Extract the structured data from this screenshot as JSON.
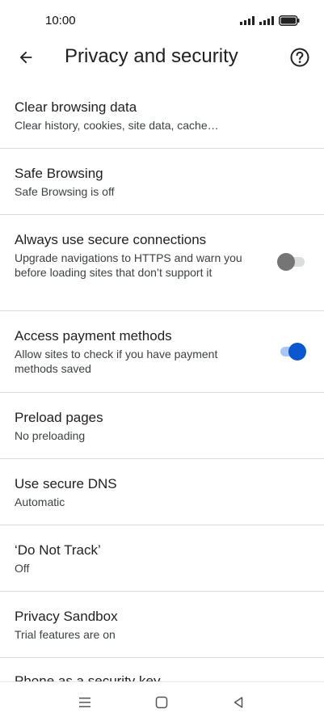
{
  "status_bar": {
    "time": "10:00"
  },
  "app_bar": {
    "title": "Privacy and security",
    "back_icon": "arrow-back-icon",
    "help_icon": "help-circle-icon"
  },
  "settings": [
    {
      "title": "Clear browsing data",
      "subtitle": "Clear history, cookies, site data, cache…"
    },
    {
      "title": "Safe Browsing",
      "subtitle": "Safe Browsing is off"
    },
    {
      "title": "Always use secure connections",
      "subtitle": "Upgrade navigations to HTTPS and warn you before loading sites that don’t support it",
      "toggle": "off"
    },
    {
      "title": "Access payment methods",
      "subtitle": "Allow sites to check if you have payment methods saved",
      "toggle": "on"
    },
    {
      "title": "Preload pages",
      "subtitle": "No preloading"
    },
    {
      "title": "Use secure DNS",
      "subtitle": "Automatic"
    },
    {
      "title": "‘Do Not Track’",
      "subtitle": "Off"
    },
    {
      "title": "Privacy Sandbox",
      "subtitle": "Trial features are on"
    }
  ],
  "partial_item": {
    "title": "Phone as a security key"
  },
  "colors": {
    "toggle_on_thumb": "#0b57d0",
    "toggle_on_track": "#a8c7fa",
    "toggle_off_thumb": "#757575",
    "toggle_off_track": "#dadce0",
    "divider": "#dadce0"
  },
  "nav_bar": {
    "icons": [
      "menu-icon",
      "home-square-icon",
      "back-triangle-icon"
    ]
  }
}
